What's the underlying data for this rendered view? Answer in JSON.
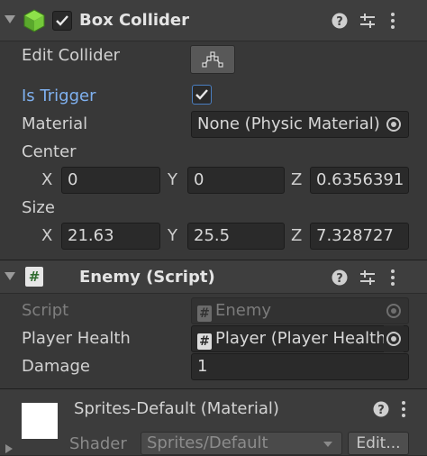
{
  "box_collider": {
    "title": "Box Collider",
    "enabled": true,
    "edit_collider_label": "Edit Collider",
    "is_trigger_label": "Is Trigger",
    "is_trigger": true,
    "material_label": "Material",
    "material_value": "None (Physic Material)",
    "center_label": "Center",
    "center": {
      "x_label": "X",
      "x": "0",
      "y_label": "Y",
      "y": "0",
      "z_label": "Z",
      "z": "0.6356391"
    },
    "size_label": "Size",
    "size": {
      "x_label": "X",
      "x": "21.63",
      "y_label": "Y",
      "y": "25.5",
      "z_label": "Z",
      "z": "7.328727"
    }
  },
  "enemy_script": {
    "title": "Enemy (Script)",
    "script_label": "Script",
    "script_value": "Enemy",
    "player_health_label": "Player Health",
    "player_health_value": "Player (Player Health)",
    "damage_label": "Damage",
    "damage_value": "1"
  },
  "material_section": {
    "title": "Sprites-Default (Material)",
    "shader_label": "Shader",
    "shader_value": "Sprites/Default",
    "edit_button": "Edit..."
  },
  "icons": {
    "help": "help-icon",
    "presets": "presets-icon",
    "menu": "more-menu-icon",
    "foldout": "foldout-arrow-icon",
    "cube": "box-collider-cube-icon",
    "script": "script-icon",
    "target": "object-picker-icon"
  },
  "colors": {
    "accent_blue": "#7fb1f0",
    "background": "#383838",
    "header": "#3e3e3e",
    "field": "#2a2a2a"
  }
}
